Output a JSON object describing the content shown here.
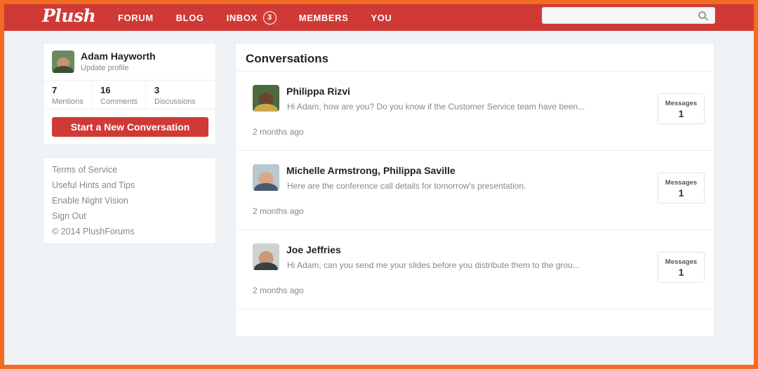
{
  "header": {
    "logo": "Plush",
    "nav": [
      {
        "label": "FORUM"
      },
      {
        "label": "BLOG"
      },
      {
        "label": "INBOX",
        "badge": "3"
      },
      {
        "label": "MEMBERS"
      },
      {
        "label": "YOU"
      }
    ],
    "search": {
      "placeholder": "",
      "value": ""
    }
  },
  "profile": {
    "name": "Adam Hayworth",
    "update_link": "Update profile",
    "stats": [
      {
        "value": "7",
        "label": "Mentions"
      },
      {
        "value": "16",
        "label": "Comments"
      },
      {
        "value": "3",
        "label": "Discussions"
      }
    ],
    "new_conversation_label": "Start a New Conversation"
  },
  "footer_links": {
    "items": [
      "Terms of Service",
      "Useful Hints and Tips",
      "Enable Night Vision",
      "Sign Out"
    ],
    "copyright": "© 2014 PlushForums"
  },
  "conversations": {
    "title": "Conversations",
    "items": [
      {
        "participants": "Philippa Rizvi",
        "preview": "Hi Adam, how are you? Do you know if the Customer Service team have been...",
        "time": "2 months ago",
        "messages_label": "Messages",
        "messages_count": "1"
      },
      {
        "participants": "Michelle Armstrong, Philippa Saville",
        "preview": "Here are the conference call details for tomorrow's presentation.",
        "time": "2 months ago",
        "messages_label": "Messages",
        "messages_count": "1"
      },
      {
        "participants": "Joe Jeffries",
        "preview": "Hi Adam, can you send me your slides before you distribute them to the grou...",
        "time": "2 months ago",
        "messages_label": "Messages",
        "messages_count": "1"
      }
    ]
  },
  "colors": {
    "brand_red": "#cf3a36",
    "frame_orange": "#f26c22"
  }
}
